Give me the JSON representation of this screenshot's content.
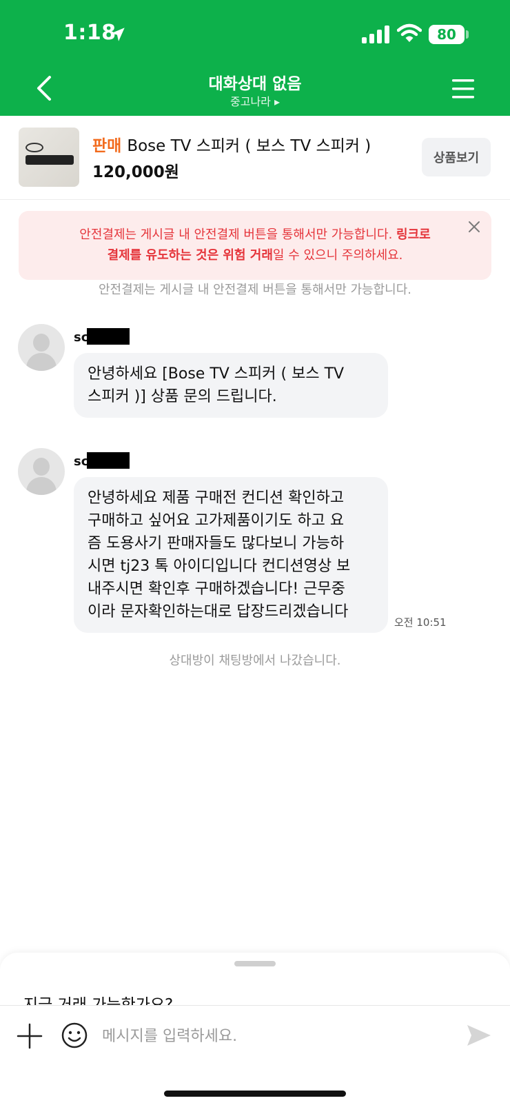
{
  "status": {
    "time": "1:18",
    "battery": "80"
  },
  "header": {
    "title": "대화상대 없음",
    "subtitle": "중고나라 ▸"
  },
  "product": {
    "tag": "판매",
    "name": "Bose TV 스피커 ( 보스 TV 스피커 )",
    "price": "120,000원",
    "view_button": "상품보기"
  },
  "warning": {
    "line1_normal": "안전결제는 게시글 내 안전결제 버튼을 통해서만 가능합니다. ",
    "line1_bold": "링크로",
    "line2_bold": "결제를 유도하는 것은 위험 거래",
    "line2_normal": "일 수 있으니 주의하세요."
  },
  "notice": "안전결제는 게시글 내 안전결제 버튼을 통해서만 가능합니다.",
  "messages": [
    {
      "sender": "sc",
      "lines": [
        "안녕하세요 [Bose TV 스피커 ( 보스 TV",
        "스피커 )] 상품 문의 드립니다."
      ],
      "time": ""
    },
    {
      "sender": "sc",
      "lines": [
        "안녕하세요 제품 구매전 컨디션 확인하고",
        "구매하고 싶어요 고가제품이기도 하고 요",
        "즘 도용사기 판매자들도  많다보니 가능하",
        "시면 tj23 톡 아이디입니다 컨디션영상 보",
        "내주시면 확인후 구매하겠습니다! 근무중",
        "이라 문자확인하는대로 답장드리겠습니다"
      ],
      "time": "오전 10:51"
    }
  ],
  "left_notice": "상대방이 채팅방에서 나갔습니다.",
  "composer": {
    "suggestion": "지금 거래 가능한가요?",
    "placeholder": "메시지를 입력하세요."
  },
  "colors": {
    "brand": "#0db14b",
    "sale": "#f26b1d",
    "warning": "#e5343a"
  },
  "icons": [
    "location-arrow-icon",
    "signal-icon",
    "wifi-icon",
    "back-chevron-icon",
    "menu-icon",
    "close-icon",
    "avatar-icon",
    "plus-icon",
    "emoji-icon",
    "send-icon"
  ]
}
